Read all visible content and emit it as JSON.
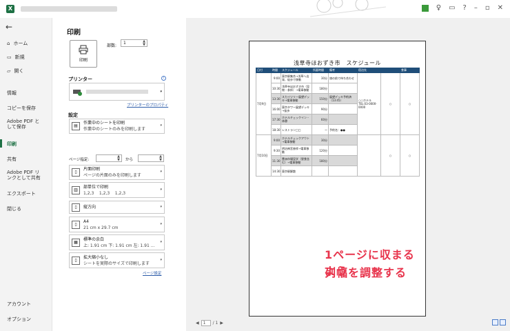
{
  "app": {
    "logo": "X"
  },
  "nav": {
    "back_icon": "←",
    "items": [
      {
        "label": "ホーム",
        "icon": "⌂"
      },
      {
        "label": "新規",
        "icon": "▭"
      },
      {
        "label": "開く",
        "icon": "▱"
      },
      {
        "label": "情報"
      },
      {
        "label": "コピーを保存"
      },
      {
        "label": "Adobe PDF と\nして保存"
      },
      {
        "label": "印刷"
      },
      {
        "label": "共有"
      },
      {
        "label": "Adobe PDF リ\nンクとして共有"
      },
      {
        "label": "エクスポート"
      },
      {
        "label": "閉じる"
      },
      {
        "label": "アカウント"
      },
      {
        "label": "オプション"
      }
    ]
  },
  "print": {
    "title": "印刷",
    "button_label": "印刷",
    "copies_label": "部数:",
    "copies_value": "1",
    "printer_heading": "プリンター",
    "printer_props": "プリンターのプロパティ",
    "settings_heading": "設定",
    "pages_label": "ページ指定:",
    "pages_to": "から",
    "page_setup": "ページ設定",
    "settings": [
      {
        "main": "作業中のシートを印刷",
        "sub": "作業中のシートのみを印刷します",
        "icon": "▤"
      },
      {
        "main": "片面印刷",
        "sub": "ページの片面のみを印刷します",
        "icon": "▯"
      },
      {
        "main": "部単位で印刷",
        "sub": "1,2,3    1,2,3    1,2,3",
        "icon": "▥"
      },
      {
        "main": "縦方向",
        "sub": "",
        "icon": "▯"
      },
      {
        "main": "A4",
        "sub": "21 cm x 29.7 cm",
        "icon": "▯"
      },
      {
        "main": "標準の余白",
        "sub": "上: 1.91 cm 下: 1.91 cm 左: 1.91 ...",
        "icon": "▦"
      },
      {
        "main": "拡大縮小なし",
        "sub": "シートを実際のサイズで印刷します",
        "icon": "▯"
      }
    ]
  },
  "preview": {
    "sheet_title": "浅草寺ほおずき市　スケジュール",
    "headers": [
      "日付",
      "時間",
      "スケジュール",
      "所要時間",
      "備考",
      "宿泊先",
      "",
      "食事"
    ],
    "rows": [
      {
        "date": "7月9日",
        "time": "9:00",
        "sched": "東京駅集合→浅草へ出発、徒歩で移動",
        "dur": "30分",
        "note": "旅の前で待ち合わせ",
        "hotel": "",
        "m1": "",
        "m2": "",
        "gray": false
      },
      {
        "date": "",
        "time": "10:30",
        "sched": "浅草寺ほおずき市（見物・参拝）→電車移動",
        "dur": "180分",
        "note": "",
        "hotel": "",
        "m1": "",
        "m2": "",
        "gray": false
      },
      {
        "date": "",
        "time": "13:30",
        "sched": "スカイツリー展望デッキ→電車移動",
        "dur": "150分",
        "note": "展望デッキ予約済（13:45）",
        "hotel": "",
        "m1": "",
        "m2": "",
        "gray": true
      },
      {
        "date": "",
        "time": "16:00",
        "sched": "東京タワー展望デッキ→徒歩",
        "dur": "90分",
        "note": "",
        "hotel": "○○ホテル\nTEL:03-0000-0000",
        "m1": "○",
        "m2": "○",
        "gray": false
      },
      {
        "date": "",
        "time": "17:30",
        "sched": "ホテルチェックイン・休憩",
        "dur": "60分",
        "note": "",
        "hotel": "",
        "m1": "",
        "m2": "",
        "gray": true
      },
      {
        "date": "",
        "time": "18:30",
        "sched": "レストラン□□",
        "dur": "ー",
        "note": "予約名：●●",
        "hotel": "",
        "m1": "",
        "m2": "",
        "gray": false
      },
      {
        "date": "7月10日",
        "time": "9:00",
        "sched": "ホテルチェックアウト→電車移動",
        "dur": "30分",
        "note": "",
        "hotel": "",
        "m1": "",
        "m2": "",
        "gray": true
      },
      {
        "date": "",
        "time": "9:30",
        "sched": "明治神宮参拝→電車移動",
        "dur": "120分",
        "note": "",
        "hotel": "",
        "m1": "○",
        "m2": "○",
        "gray": false
      },
      {
        "date": "",
        "time": "11:30",
        "sched": "豊洲市場見学（昼食含む）→電車移動",
        "dur": "180分",
        "note": "",
        "hotel": "",
        "m1": "",
        "m2": "",
        "gray": true
      },
      {
        "date": "",
        "time": "14:30",
        "sched": "東京駅解散",
        "dur": "",
        "note": "",
        "hotel": "",
        "m1": "",
        "m2": "",
        "gray": false
      }
    ],
    "annotation_line1": "1ページに収まるよう",
    "annotation_line2": "列幅を調整する",
    "page_current": "1",
    "page_total": "/ 1"
  }
}
